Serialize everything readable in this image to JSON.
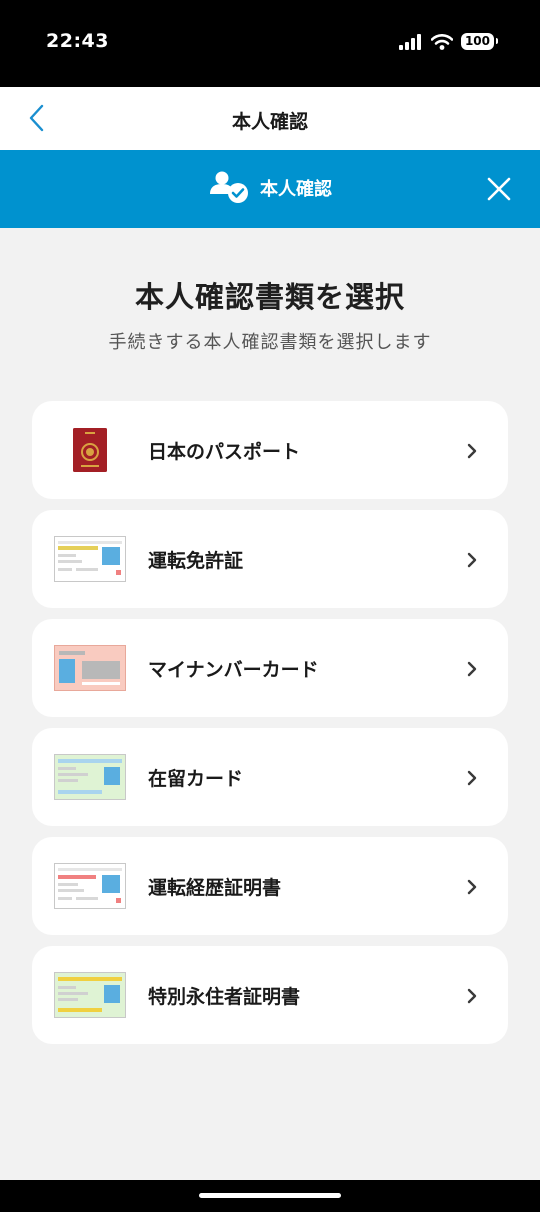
{
  "status": {
    "time": "22:43",
    "battery": "100"
  },
  "nav": {
    "title": "本人確認"
  },
  "header": {
    "title": "本人確認"
  },
  "main": {
    "title": "本人確認書類を選択",
    "subtitle": "手続きする本人確認書類を選択します"
  },
  "documents": [
    {
      "label": "日本のパスポート",
      "icon": "passport-icon"
    },
    {
      "label": "運転免許証",
      "icon": "drivers-license-icon"
    },
    {
      "label": "マイナンバーカード",
      "icon": "my-number-card-icon"
    },
    {
      "label": "在留カード",
      "icon": "residence-card-icon"
    },
    {
      "label": "運転経歴証明書",
      "icon": "driving-history-certificate-icon"
    },
    {
      "label": "特別永住者証明書",
      "icon": "special-permanent-resident-certificate-icon"
    }
  ],
  "colors": {
    "accent": "#0092cf",
    "background": "#f2f2f2",
    "back_chevron": "#1a8fd0"
  }
}
